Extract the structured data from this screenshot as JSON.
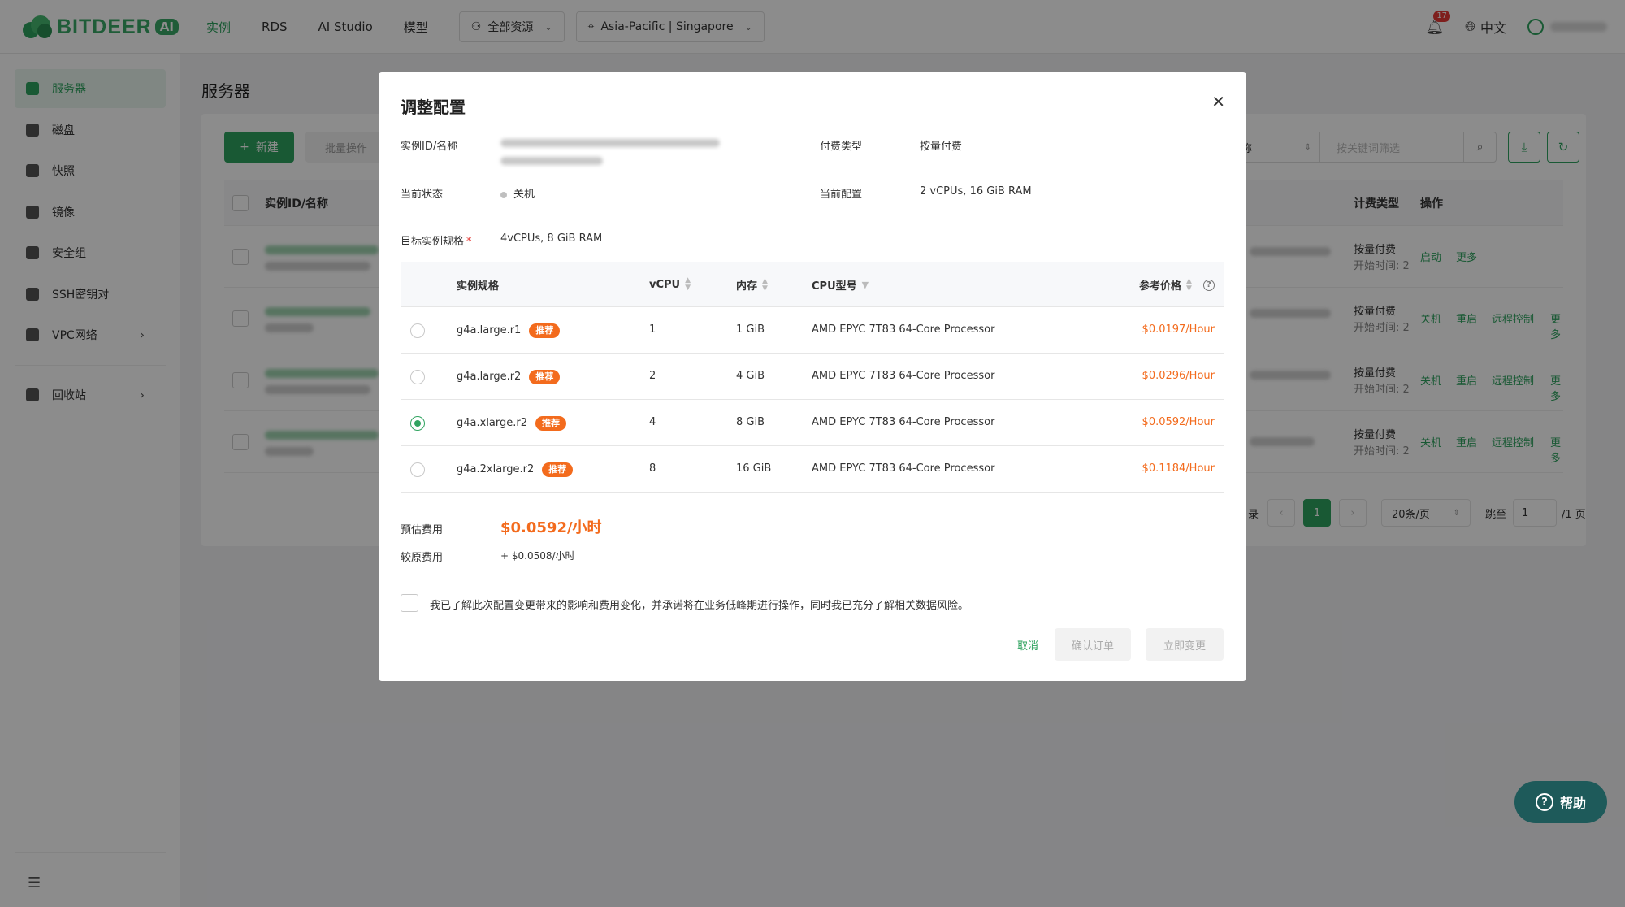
{
  "brand": {
    "name": "BITDEER",
    "ai_badge": "AI"
  },
  "topnav": {
    "items": [
      "实例",
      "RDS",
      "AI Studio",
      "模型"
    ],
    "resource_dropdown": "全部资源",
    "region_dropdown": "Asia-Pacific | Singapore"
  },
  "header": {
    "notification_count": "17",
    "language": "中文"
  },
  "sidebar": {
    "items": [
      {
        "label": "服务器"
      },
      {
        "label": "磁盘"
      },
      {
        "label": "快照"
      },
      {
        "label": "镜像"
      },
      {
        "label": "安全组"
      },
      {
        "label": "SSH密钥对"
      },
      {
        "label": "VPC网络"
      },
      {
        "label": "回收站"
      }
    ]
  },
  "page": {
    "title": "服务器",
    "new_button": "新建",
    "batch_button": "批量操作",
    "search_field": "名称",
    "search_placeholder": "按关键词筛选",
    "columns": {
      "id_name": "实例ID/名称",
      "billing": "计费类型",
      "ops": "操作"
    },
    "rows": [
      {
        "billing": "按量付费",
        "start": "开始时间: 2",
        "ops": [
          "启动",
          "更多"
        ]
      },
      {
        "billing": "按量付费",
        "start": "开始时间: 2",
        "ops": [
          "关机",
          "重启",
          "远程控制",
          "更多"
        ]
      },
      {
        "billing": "按量付费",
        "start": "开始时间: 2",
        "ops": [
          "关机",
          "重启",
          "远程控制",
          "更多"
        ]
      },
      {
        "billing": "按量付费",
        "start": "开始时间: 2",
        "ops": [
          "关机",
          "重启",
          "远程控制",
          "更多"
        ]
      }
    ],
    "pager": {
      "total_suffix": "录",
      "current": "1",
      "page_size": "20条/页",
      "jump_label": "跳至",
      "jump_value": "1",
      "pages_suffix": "/1 页"
    }
  },
  "modal": {
    "title": "调整配置",
    "fields": {
      "instance_label": "实例ID/名称",
      "pay_type_label": "付费类型",
      "pay_type_value": "按量付费",
      "status_label": "当前状态",
      "status_value": "关机",
      "current_config_label": "当前配置",
      "current_config_value": "2 vCPUs, 16 GiB RAM",
      "target_label": "目标实例规格",
      "target_value": "4vCPUs, 8 GiB RAM"
    },
    "table": {
      "headers": {
        "spec": "实例规格",
        "vcpu": "vCPU",
        "memory": "内存",
        "cpu_model": "CPU型号",
        "price": "参考价格"
      },
      "recommend_tag": "推荐",
      "selected_index": 2,
      "rows": [
        {
          "spec": "g4a.large.r1",
          "vcpu": "1",
          "memory": "1 GiB",
          "cpu": "AMD EPYC 7T83 64-Core Processor",
          "price": "$0.0197/Hour"
        },
        {
          "spec": "g4a.large.r2",
          "vcpu": "2",
          "memory": "4 GiB",
          "cpu": "AMD EPYC 7T83 64-Core Processor",
          "price": "$0.0296/Hour"
        },
        {
          "spec": "g4a.xlarge.r2",
          "vcpu": "4",
          "memory": "8 GiB",
          "cpu": "AMD EPYC 7T83 64-Core Processor",
          "price": "$0.0592/Hour"
        },
        {
          "spec": "g4a.2xlarge.r2",
          "vcpu": "8",
          "memory": "16 GiB",
          "cpu": "AMD EPYC 7T83 64-Core Processor",
          "price": "$0.1184/Hour"
        }
      ]
    },
    "estimate_label": "预估费用",
    "estimate_value": "$0.0592/小时",
    "original_label": "较原费用",
    "original_value": "+ $0.0508/小时",
    "agreement": "我已了解此次配置变更带来的影响和费用变化，并承诺将在业务低峰期进行操作，同时我已充分了解相关数据风险。",
    "cancel": "取消",
    "confirm_order": "确认订单",
    "change_now": "立即变更"
  },
  "help_button": "帮助",
  "colors": {
    "brand_green": "#2fa35f",
    "price_orange": "#f36b1d",
    "help_bg": "#1e5a5a"
  }
}
